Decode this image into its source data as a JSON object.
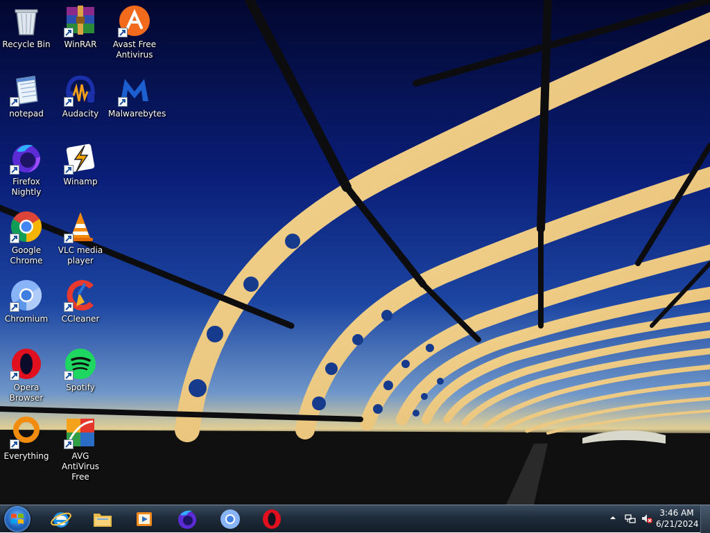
{
  "desktop": {
    "icons": [
      {
        "label": "Recycle Bin",
        "icon": "recycle-bin-icon",
        "shortcut": false
      },
      {
        "label": "WinRAR",
        "icon": "winrar-icon",
        "shortcut": true
      },
      {
        "label": "Avast Free Antivirus",
        "icon": "avast-icon",
        "shortcut": true
      },
      {
        "label": "notepad",
        "icon": "notepad-icon",
        "shortcut": true
      },
      {
        "label": "Audacity",
        "icon": "audacity-icon",
        "shortcut": true
      },
      {
        "label": "Malwarebytes",
        "icon": "malwarebytes-icon",
        "shortcut": true
      },
      {
        "label": "Firefox Nightly",
        "icon": "firefox-nightly-icon",
        "shortcut": true
      },
      {
        "label": "Winamp",
        "icon": "winamp-icon",
        "shortcut": true
      },
      {
        "label": "Google Chrome",
        "icon": "chrome-icon",
        "shortcut": true
      },
      {
        "label": "VLC media player",
        "icon": "vlc-icon",
        "shortcut": true
      },
      {
        "label": "Chromium",
        "icon": "chromium-icon",
        "shortcut": true
      },
      {
        "label": "CCleaner",
        "icon": "ccleaner-icon",
        "shortcut": true
      },
      {
        "label": "Opera Browser",
        "icon": "opera-icon",
        "shortcut": true
      },
      {
        "label": "Spotify",
        "icon": "spotify-icon",
        "shortcut": true
      },
      {
        "label": "Everything",
        "icon": "everything-icon",
        "shortcut": true
      },
      {
        "label": "AVG AntiVirus Free",
        "icon": "avg-icon",
        "shortcut": true
      }
    ]
  },
  "taskbar": {
    "start": "windows-orb-icon",
    "pinned": [
      {
        "name": "internet-explorer",
        "icon": "internet-explorer-icon"
      },
      {
        "name": "file-explorer",
        "icon": "folder-icon"
      },
      {
        "name": "media-player",
        "icon": "media-player-icon"
      },
      {
        "name": "firefox-nightly",
        "icon": "firefox-nightly-icon"
      },
      {
        "name": "chromium",
        "icon": "chromium-icon"
      },
      {
        "name": "opera",
        "icon": "opera-icon"
      }
    ],
    "tray": {
      "time": "3:46 AM",
      "date": "6/21/2024",
      "icons": [
        "chevron-up-icon",
        "network-icon",
        "volume-muted-icon"
      ]
    }
  },
  "colors": {
    "sky_top": "#040a3a",
    "sky_mid": "#173e9c",
    "horizon": "#d9c98f",
    "taskbar": "#1f2c3b"
  }
}
